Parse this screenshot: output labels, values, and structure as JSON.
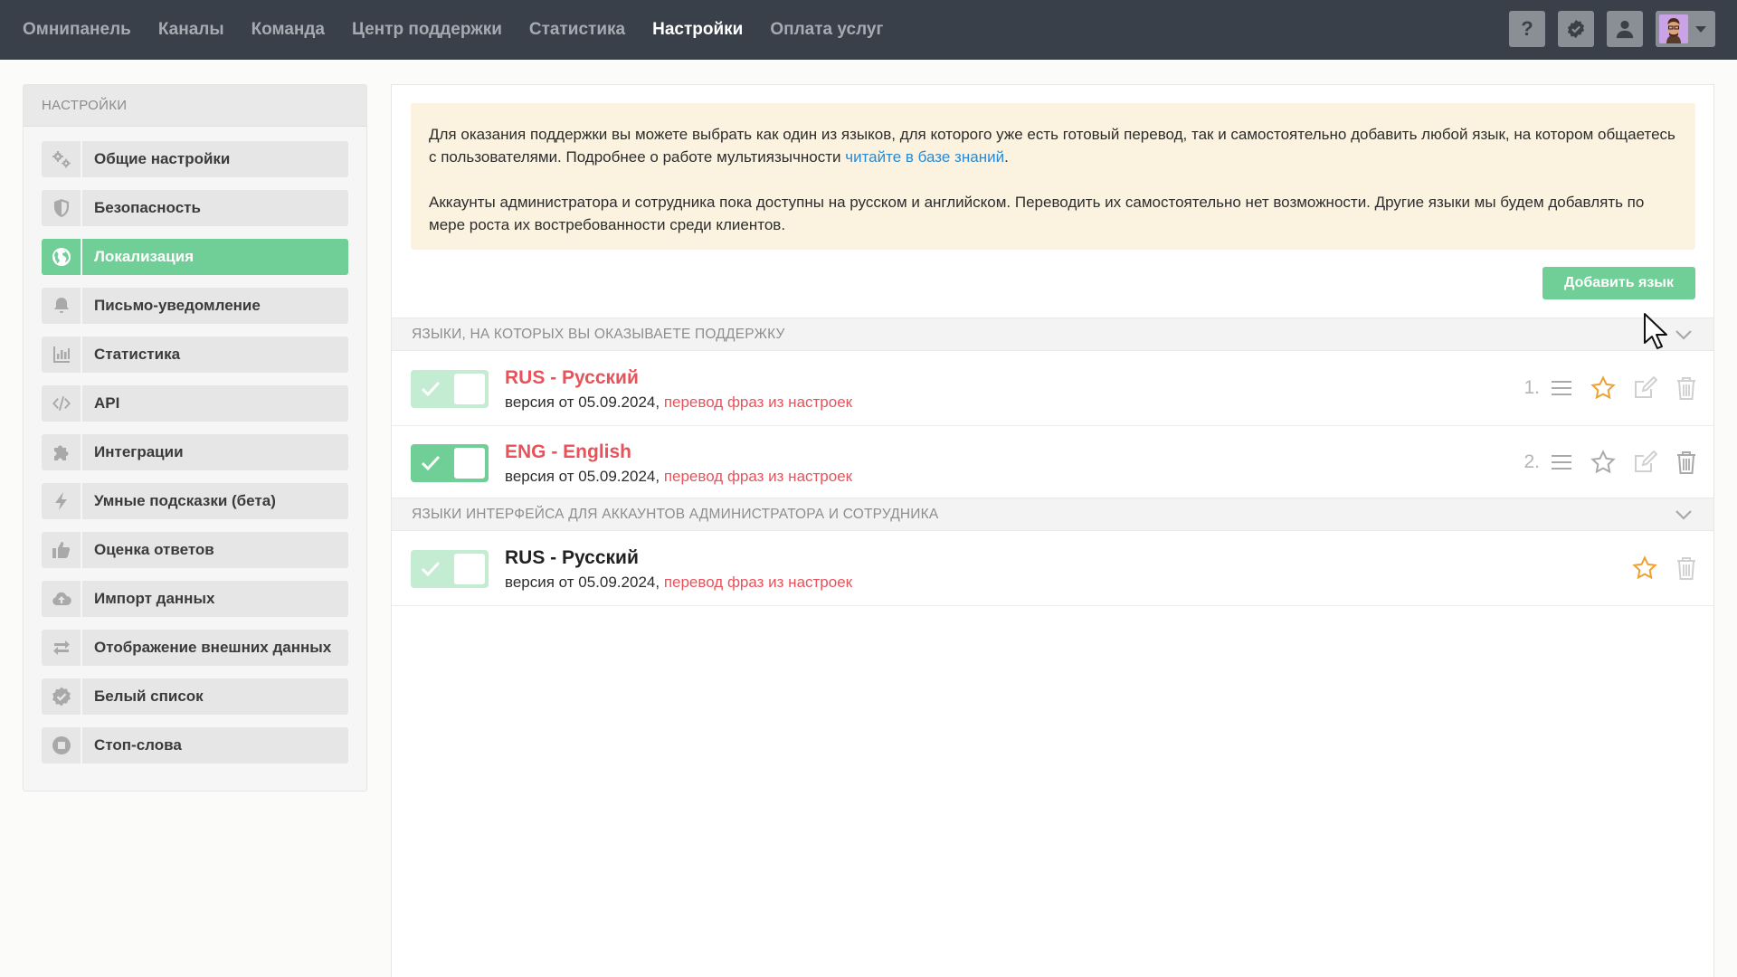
{
  "nav": {
    "items": [
      {
        "label": "Омнипанель",
        "active": false
      },
      {
        "label": "Каналы",
        "active": false
      },
      {
        "label": "Команда",
        "active": false
      },
      {
        "label": "Центр поддержки",
        "active": false
      },
      {
        "label": "Статистика",
        "active": false
      },
      {
        "label": "Настройки",
        "active": true
      },
      {
        "label": "Оплата услуг",
        "active": false
      }
    ],
    "help_label": "?"
  },
  "sidebar": {
    "title": "НАСТРОЙКИ",
    "items": [
      {
        "label": "Общие настройки",
        "icon": "gears-icon",
        "active": false
      },
      {
        "label": "Безопасность",
        "icon": "shield-icon",
        "active": false
      },
      {
        "label": "Локализация",
        "icon": "globe-icon",
        "active": true
      },
      {
        "label": "Письмо-уведомление",
        "icon": "bell-icon",
        "active": false
      },
      {
        "label": "Статистика",
        "icon": "bar-chart-icon",
        "active": false
      },
      {
        "label": "API",
        "icon": "code-icon",
        "active": false
      },
      {
        "label": "Интеграции",
        "icon": "puzzle-icon",
        "active": false
      },
      {
        "label": "Умные подсказки (бета)",
        "icon": "lightning-icon",
        "active": false
      },
      {
        "label": "Оценка ответов",
        "icon": "thumbs-up-icon",
        "active": false
      },
      {
        "label": "Импорт данных",
        "icon": "cloud-upload-icon",
        "active": false
      },
      {
        "label": "Отображение внешних данных",
        "icon": "exchange-icon",
        "active": false
      },
      {
        "label": "Белый список",
        "icon": "check-badge-icon",
        "active": false
      },
      {
        "label": "Стоп-слова",
        "icon": "stop-icon",
        "active": false
      }
    ]
  },
  "notice": {
    "p1_text": "Для оказания поддержки вы можете выбрать как один из языков, для которого уже есть готовый перевод, так и самостоятельно добавить любой язык, на котором общаетесь с пользователями. Подробнее о работе мультиязычности ",
    "p1_link": "читайте в базе знаний",
    "p1_end": ".",
    "p2_text": "Аккаунты администратора и сотрудника пока доступны на русском и английском. Переводить их самостоятельно нет возможности. Другие языки мы будем добавлять по мере роста их востребованности среди клиентов."
  },
  "add_language_label": "Добавить язык",
  "support_section": {
    "title": "ЯЗЫКИ, НА КОТОРЫХ ВЫ ОКАЗЫВАЕТЕ ПОДДЕРЖКУ",
    "languages": [
      {
        "name": "RUS - Русский",
        "version": "версия от 05.09.2024,",
        "link": "перевод фраз из настроек",
        "order": "1.",
        "enabled": true,
        "default": true
      },
      {
        "name": "ENG - English",
        "version": "версия от 05.09.2024,",
        "link": "перевод фраз из настроек",
        "order": "2.",
        "enabled": true,
        "default": false
      }
    ]
  },
  "interface_section": {
    "title": "ЯЗЫКИ ИНТЕРФЕЙСА ДЛЯ АККАУНТОВ АДМИНИСТРАТОРА И СОТРУДНИКА",
    "languages": [
      {
        "name": "RUS - Русский",
        "version": "версия от 05.09.2024,",
        "link": "перевод фраз из настроек",
        "enabled": true,
        "default": true
      }
    ]
  },
  "colors": {
    "topbar": "#3a4049",
    "accent_green": "#6fcf97",
    "accent_red": "#e8525a",
    "link_blue": "#2a8ad1",
    "star_orange": "#f0a030",
    "notice_bg": "#fbf3e0"
  }
}
